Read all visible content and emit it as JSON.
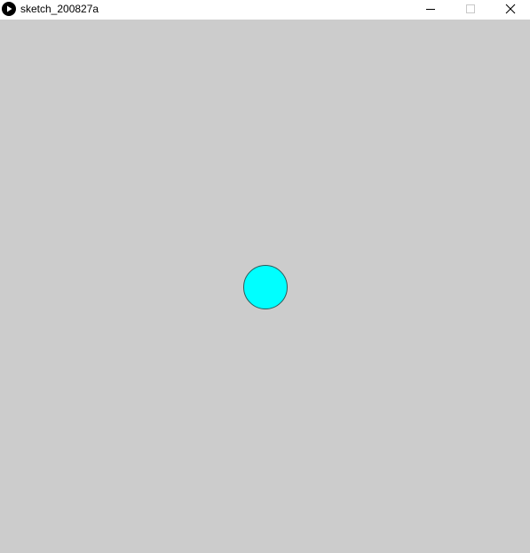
{
  "window": {
    "title": "sketch_200827a",
    "app_icon": "play-icon",
    "controls": {
      "minimize": "minimize-icon",
      "maximize": "maximize-icon",
      "close": "close-icon"
    }
  },
  "canvas": {
    "background": "#cccccc",
    "shape": {
      "type": "circle",
      "fill": "#00ffff",
      "stroke": "#2f5a5a"
    }
  }
}
